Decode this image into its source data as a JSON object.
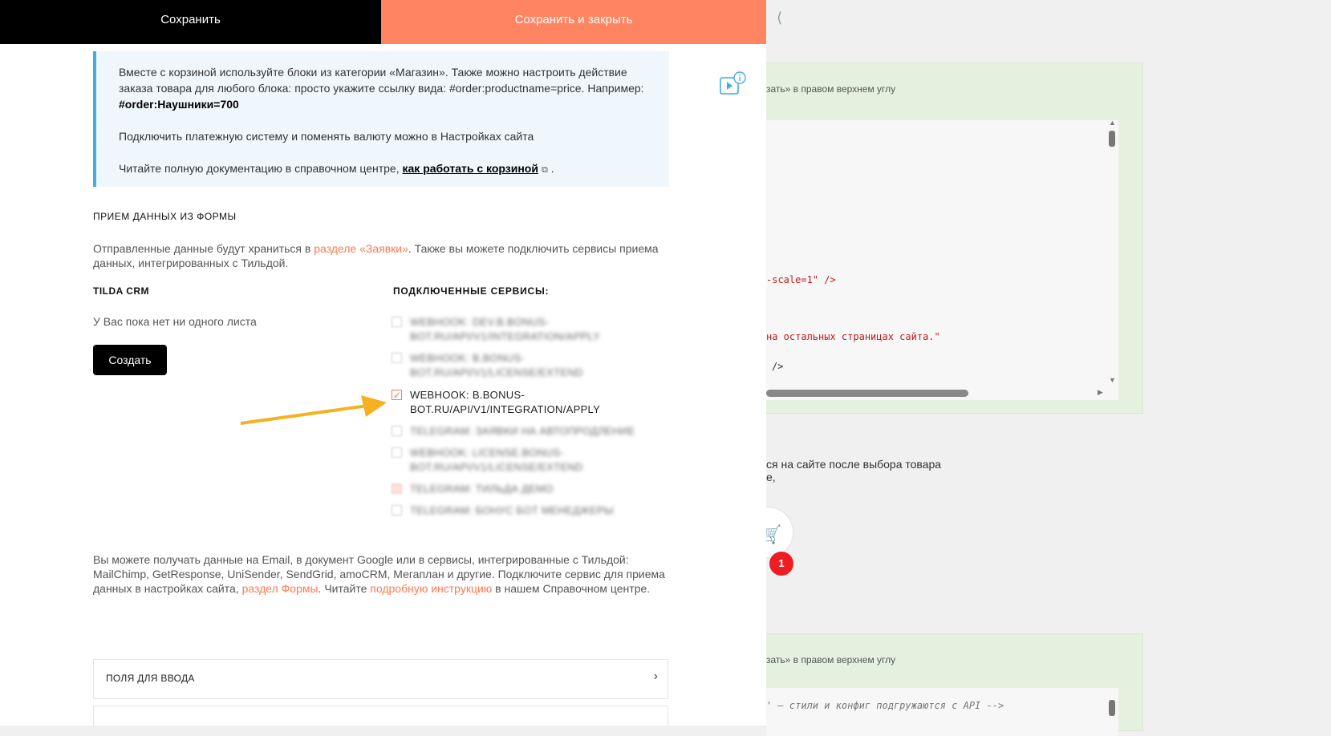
{
  "toolbar": {
    "save_label": "Сохранить",
    "save_close_label": "Сохранить и закрыть"
  },
  "info": {
    "line1": "Вместе с корзиной используйте блоки из категории «Магазин». Также можно настроить действие заказа товара для любого блока: просто укажите ссылку вида: #order:productname=price. Например: ",
    "example": "#order:Наушники=700",
    "line2": "Подключить платежную систему и поменять валюту можно в Настройках сайта",
    "line3": "Читайте полную документацию в справочном центре, ",
    "doc_link": "как работать с корзиной",
    "line3_end": " ."
  },
  "form_section": {
    "title": "ПРИЕМ ДАННЫХ ИЗ ФОРМЫ",
    "desc_before": "Отправленные данные будут храниться в ",
    "desc_link": "разделе «Заявки»",
    "desc_after": ". Также вы можете подключить сервисы приема данных, интегрированных с Тильдой."
  },
  "crm": {
    "title": "TILDA CRM",
    "empty_text": "У Вас пока нет ни одного листа",
    "create_label": "Создать"
  },
  "services": {
    "title": "ПОДКЛЮЧЕННЫЕ СЕРВИСЫ:",
    "items": [
      {
        "label": "WEBHOOK: DEV.B.BONUS-BOT.RU/API/V1/INTEGRATION/APPLY",
        "checked": false,
        "blurred": true
      },
      {
        "label": "WEBHOOK: B.BONUS-BOT.RU/API/V1/LICENSE/EXTEND",
        "checked": false,
        "blurred": true
      },
      {
        "label": "WEBHOOK: B.BONUS-BOT.RU/API/V1/INTEGRATION/APPLY",
        "checked": true,
        "blurred": false
      },
      {
        "label": "TELEGRAM: ЗАЯВКИ НА АВТОПРОДЛЕНИЕ",
        "checked": false,
        "blurred": true
      },
      {
        "label": "WEBHOOK: LICENSE.BONUS-BOT.RU/API/V1/LICENSE/EXTEND",
        "checked": false,
        "blurred": true
      },
      {
        "label": "TELEGRAM: ТИЛЬДА ДЕМО",
        "checked": false,
        "blurred": true
      },
      {
        "label": "TELEGRAM: БОНУС БОТ МЕНЕДЖЕРЫ",
        "checked": false,
        "blurred": true
      }
    ]
  },
  "bottom": {
    "text_before": "Вы можете получать данные на Email, в документ Google или в сервисы, интегрированные с Тильдой: MailChimp, GetResponse, UniSender, SendGrid, amoCRM, Мегаплан и другие. Подключите сервис для приема данных в настройках сайта, ",
    "link1": "раздел Формы",
    "text_middle": ". Читайте ",
    "link2": "подробную инструкцию",
    "text_after": " в нашем Справочном центре."
  },
  "fields_row": {
    "label": "ПОЛЯ ДЛЯ ВВОДА"
  },
  "background": {
    "chevron": "⟨",
    "note1": "зать» в правом верхнем углу",
    "code1": "-scale=1\" />",
    "code2": "на остальных страницах сайта.\"",
    "code3": "/>",
    "text1": "ся на сайте после выбора товара",
    "text2": "е,",
    "badge": "1",
    "note2": "зать» в правом верхнем углу",
    "code4": "' — стили и конфиг подгружаются с API -->"
  },
  "colors": {
    "accent": "#ff8562",
    "link": "#ff7850",
    "info_border": "#42aee0",
    "info_bg": "#f0f7fc",
    "badge": "#ee1d23",
    "arrow": "#f5b120"
  },
  "icons": {
    "video_info": "video-info-icon",
    "external_link": "external-link-icon",
    "cart": "cart-icon",
    "chevron_right": "chevron-right-icon"
  }
}
